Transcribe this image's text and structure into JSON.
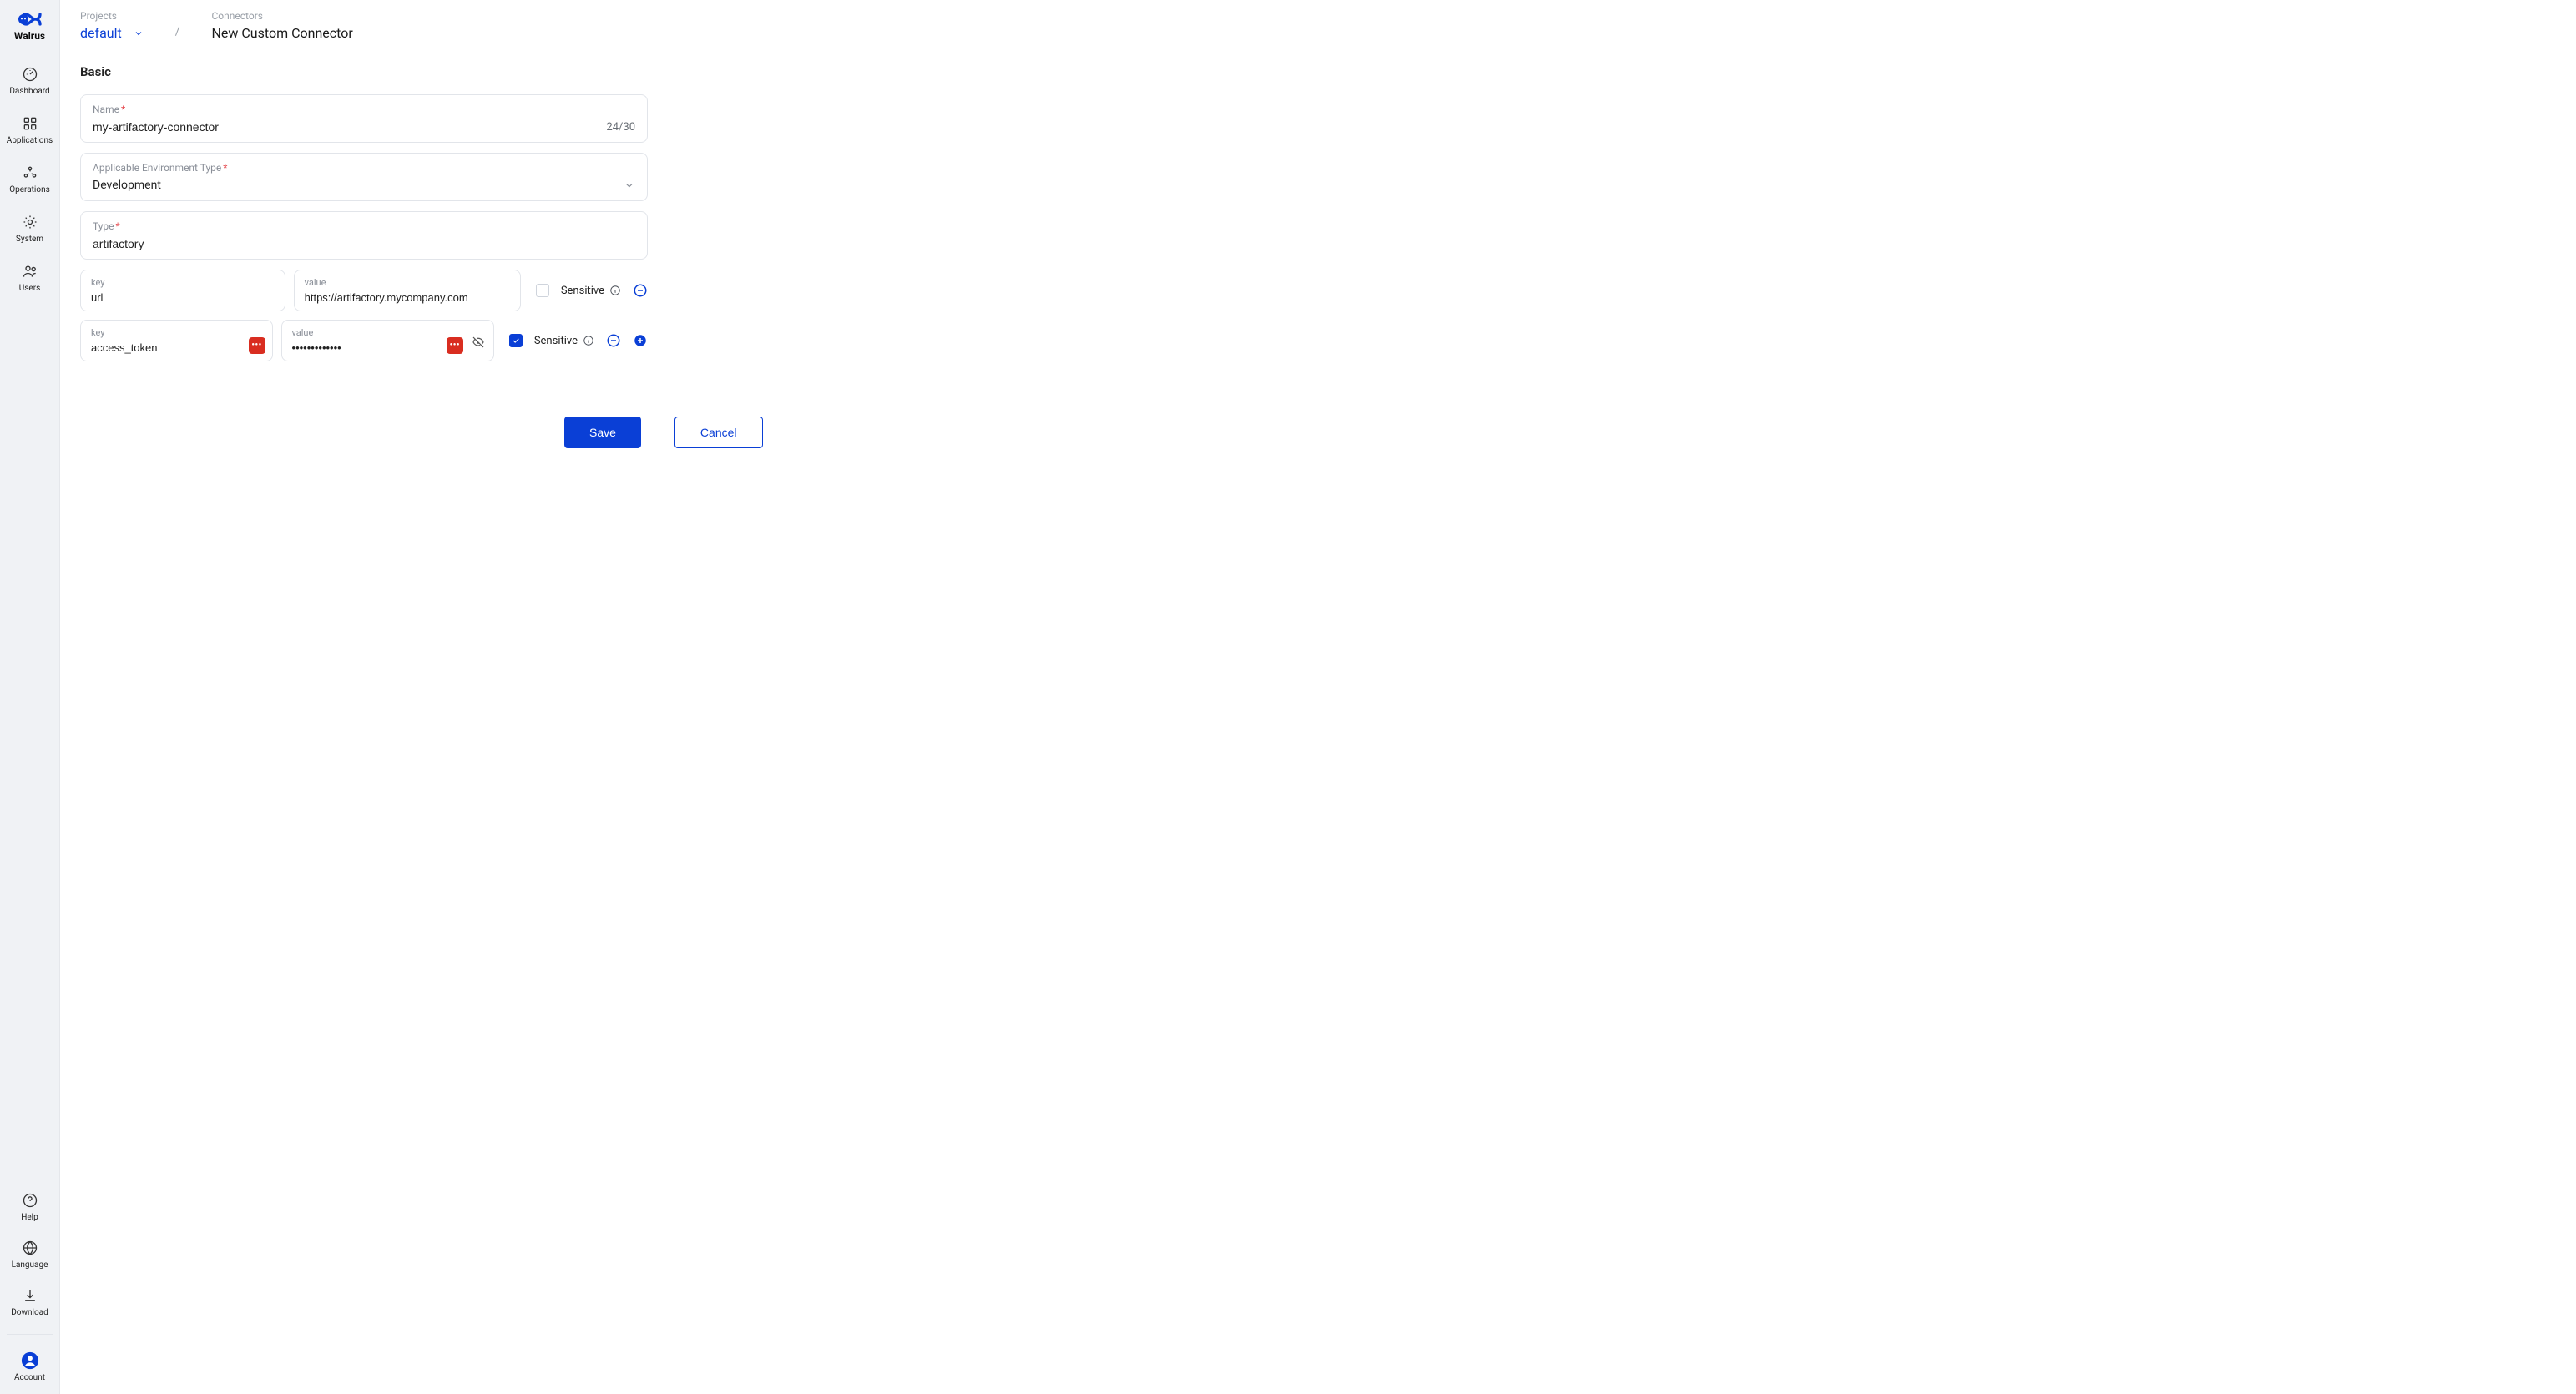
{
  "brand": "Walrus",
  "sidebar": {
    "top": [
      {
        "label": "Dashboard"
      },
      {
        "label": "Applications"
      },
      {
        "label": "Operations"
      },
      {
        "label": "System"
      },
      {
        "label": "Users"
      }
    ],
    "bottom": [
      {
        "label": "Help"
      },
      {
        "label": "Language"
      },
      {
        "label": "Download"
      },
      {
        "label": "Account"
      }
    ]
  },
  "breadcrumb": {
    "projects_lbl": "Projects",
    "project": "default",
    "sep": "/",
    "connectors_lbl": "Connectors",
    "page": "New Custom Connector"
  },
  "section": "Basic",
  "fields": {
    "name": {
      "label": "Name",
      "value": "my-artifactory-connector",
      "counter": "24/30"
    },
    "env": {
      "label": "Applicable Environment Type",
      "value": "Development"
    },
    "type": {
      "label": "Type",
      "value": "artifactory"
    }
  },
  "kv_labels": {
    "key": "key",
    "value": "value"
  },
  "kvs": [
    {
      "key": "url",
      "value": "https://artifactory.mycompany.com",
      "sensitive": false,
      "red_key": false,
      "red_val": false
    },
    {
      "key": "access_token",
      "value": "•••••••••••••",
      "sensitive": true,
      "red_key": true,
      "red_val": true
    }
  ],
  "sensitive_lbl": "Sensitive",
  "buttons": {
    "save": "Save",
    "cancel": "Cancel"
  }
}
